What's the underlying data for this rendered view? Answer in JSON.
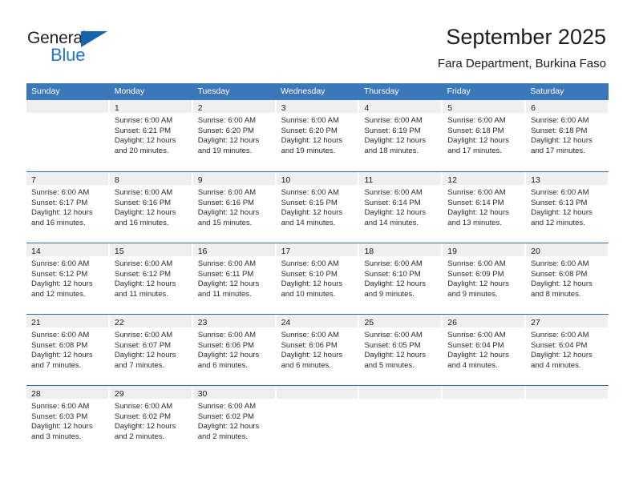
{
  "brand": {
    "logo_text_1": "General",
    "logo_text_2": "Blue",
    "logo_triangle_icon": "triangle-icon",
    "accent_color": "#3b78b9",
    "brand_blue": "#2277cc"
  },
  "header": {
    "title": "September 2025",
    "subtitle": "Fara Department, Burkina Faso"
  },
  "calendar": {
    "weekday_headers": [
      "Sunday",
      "Monday",
      "Tuesday",
      "Wednesday",
      "Thursday",
      "Friday",
      "Saturday"
    ],
    "weeks": [
      [
        {
          "day": "",
          "lines": []
        },
        {
          "day": "1",
          "lines": [
            "Sunrise: 6:00 AM",
            "Sunset: 6:21 PM",
            "Daylight: 12 hours",
            "and 20 minutes."
          ]
        },
        {
          "day": "2",
          "lines": [
            "Sunrise: 6:00 AM",
            "Sunset: 6:20 PM",
            "Daylight: 12 hours",
            "and 19 minutes."
          ]
        },
        {
          "day": "3",
          "lines": [
            "Sunrise: 6:00 AM",
            "Sunset: 6:20 PM",
            "Daylight: 12 hours",
            "and 19 minutes."
          ]
        },
        {
          "day": "4",
          "lines": [
            "Sunrise: 6:00 AM",
            "Sunset: 6:19 PM",
            "Daylight: 12 hours",
            "and 18 minutes."
          ]
        },
        {
          "day": "5",
          "lines": [
            "Sunrise: 6:00 AM",
            "Sunset: 6:18 PM",
            "Daylight: 12 hours",
            "and 17 minutes."
          ]
        },
        {
          "day": "6",
          "lines": [
            "Sunrise: 6:00 AM",
            "Sunset: 6:18 PM",
            "Daylight: 12 hours",
            "and 17 minutes."
          ]
        }
      ],
      [
        {
          "day": "7",
          "lines": [
            "Sunrise: 6:00 AM",
            "Sunset: 6:17 PM",
            "Daylight: 12 hours",
            "and 16 minutes."
          ]
        },
        {
          "day": "8",
          "lines": [
            "Sunrise: 6:00 AM",
            "Sunset: 6:16 PM",
            "Daylight: 12 hours",
            "and 16 minutes."
          ]
        },
        {
          "day": "9",
          "lines": [
            "Sunrise: 6:00 AM",
            "Sunset: 6:16 PM",
            "Daylight: 12 hours",
            "and 15 minutes."
          ]
        },
        {
          "day": "10",
          "lines": [
            "Sunrise: 6:00 AM",
            "Sunset: 6:15 PM",
            "Daylight: 12 hours",
            "and 14 minutes."
          ]
        },
        {
          "day": "11",
          "lines": [
            "Sunrise: 6:00 AM",
            "Sunset: 6:14 PM",
            "Daylight: 12 hours",
            "and 14 minutes."
          ]
        },
        {
          "day": "12",
          "lines": [
            "Sunrise: 6:00 AM",
            "Sunset: 6:14 PM",
            "Daylight: 12 hours",
            "and 13 minutes."
          ]
        },
        {
          "day": "13",
          "lines": [
            "Sunrise: 6:00 AM",
            "Sunset: 6:13 PM",
            "Daylight: 12 hours",
            "and 12 minutes."
          ]
        }
      ],
      [
        {
          "day": "14",
          "lines": [
            "Sunrise: 6:00 AM",
            "Sunset: 6:12 PM",
            "Daylight: 12 hours",
            "and 12 minutes."
          ]
        },
        {
          "day": "15",
          "lines": [
            "Sunrise: 6:00 AM",
            "Sunset: 6:12 PM",
            "Daylight: 12 hours",
            "and 11 minutes."
          ]
        },
        {
          "day": "16",
          "lines": [
            "Sunrise: 6:00 AM",
            "Sunset: 6:11 PM",
            "Daylight: 12 hours",
            "and 11 minutes."
          ]
        },
        {
          "day": "17",
          "lines": [
            "Sunrise: 6:00 AM",
            "Sunset: 6:10 PM",
            "Daylight: 12 hours",
            "and 10 minutes."
          ]
        },
        {
          "day": "18",
          "lines": [
            "Sunrise: 6:00 AM",
            "Sunset: 6:10 PM",
            "Daylight: 12 hours",
            "and 9 minutes."
          ]
        },
        {
          "day": "19",
          "lines": [
            "Sunrise: 6:00 AM",
            "Sunset: 6:09 PM",
            "Daylight: 12 hours",
            "and 9 minutes."
          ]
        },
        {
          "day": "20",
          "lines": [
            "Sunrise: 6:00 AM",
            "Sunset: 6:08 PM",
            "Daylight: 12 hours",
            "and 8 minutes."
          ]
        }
      ],
      [
        {
          "day": "21",
          "lines": [
            "Sunrise: 6:00 AM",
            "Sunset: 6:08 PM",
            "Daylight: 12 hours",
            "and 7 minutes."
          ]
        },
        {
          "day": "22",
          "lines": [
            "Sunrise: 6:00 AM",
            "Sunset: 6:07 PM",
            "Daylight: 12 hours",
            "and 7 minutes."
          ]
        },
        {
          "day": "23",
          "lines": [
            "Sunrise: 6:00 AM",
            "Sunset: 6:06 PM",
            "Daylight: 12 hours",
            "and 6 minutes."
          ]
        },
        {
          "day": "24",
          "lines": [
            "Sunrise: 6:00 AM",
            "Sunset: 6:06 PM",
            "Daylight: 12 hours",
            "and 6 minutes."
          ]
        },
        {
          "day": "25",
          "lines": [
            "Sunrise: 6:00 AM",
            "Sunset: 6:05 PM",
            "Daylight: 12 hours",
            "and 5 minutes."
          ]
        },
        {
          "day": "26",
          "lines": [
            "Sunrise: 6:00 AM",
            "Sunset: 6:04 PM",
            "Daylight: 12 hours",
            "and 4 minutes."
          ]
        },
        {
          "day": "27",
          "lines": [
            "Sunrise: 6:00 AM",
            "Sunset: 6:04 PM",
            "Daylight: 12 hours",
            "and 4 minutes."
          ]
        }
      ],
      [
        {
          "day": "28",
          "lines": [
            "Sunrise: 6:00 AM",
            "Sunset: 6:03 PM",
            "Daylight: 12 hours",
            "and 3 minutes."
          ]
        },
        {
          "day": "29",
          "lines": [
            "Sunrise: 6:00 AM",
            "Sunset: 6:02 PM",
            "Daylight: 12 hours",
            "and 2 minutes."
          ]
        },
        {
          "day": "30",
          "lines": [
            "Sunrise: 6:00 AM",
            "Sunset: 6:02 PM",
            "Daylight: 12 hours",
            "and 2 minutes."
          ]
        },
        {
          "day": "",
          "lines": []
        },
        {
          "day": "",
          "lines": []
        },
        {
          "day": "",
          "lines": []
        },
        {
          "day": "",
          "lines": []
        }
      ]
    ]
  }
}
